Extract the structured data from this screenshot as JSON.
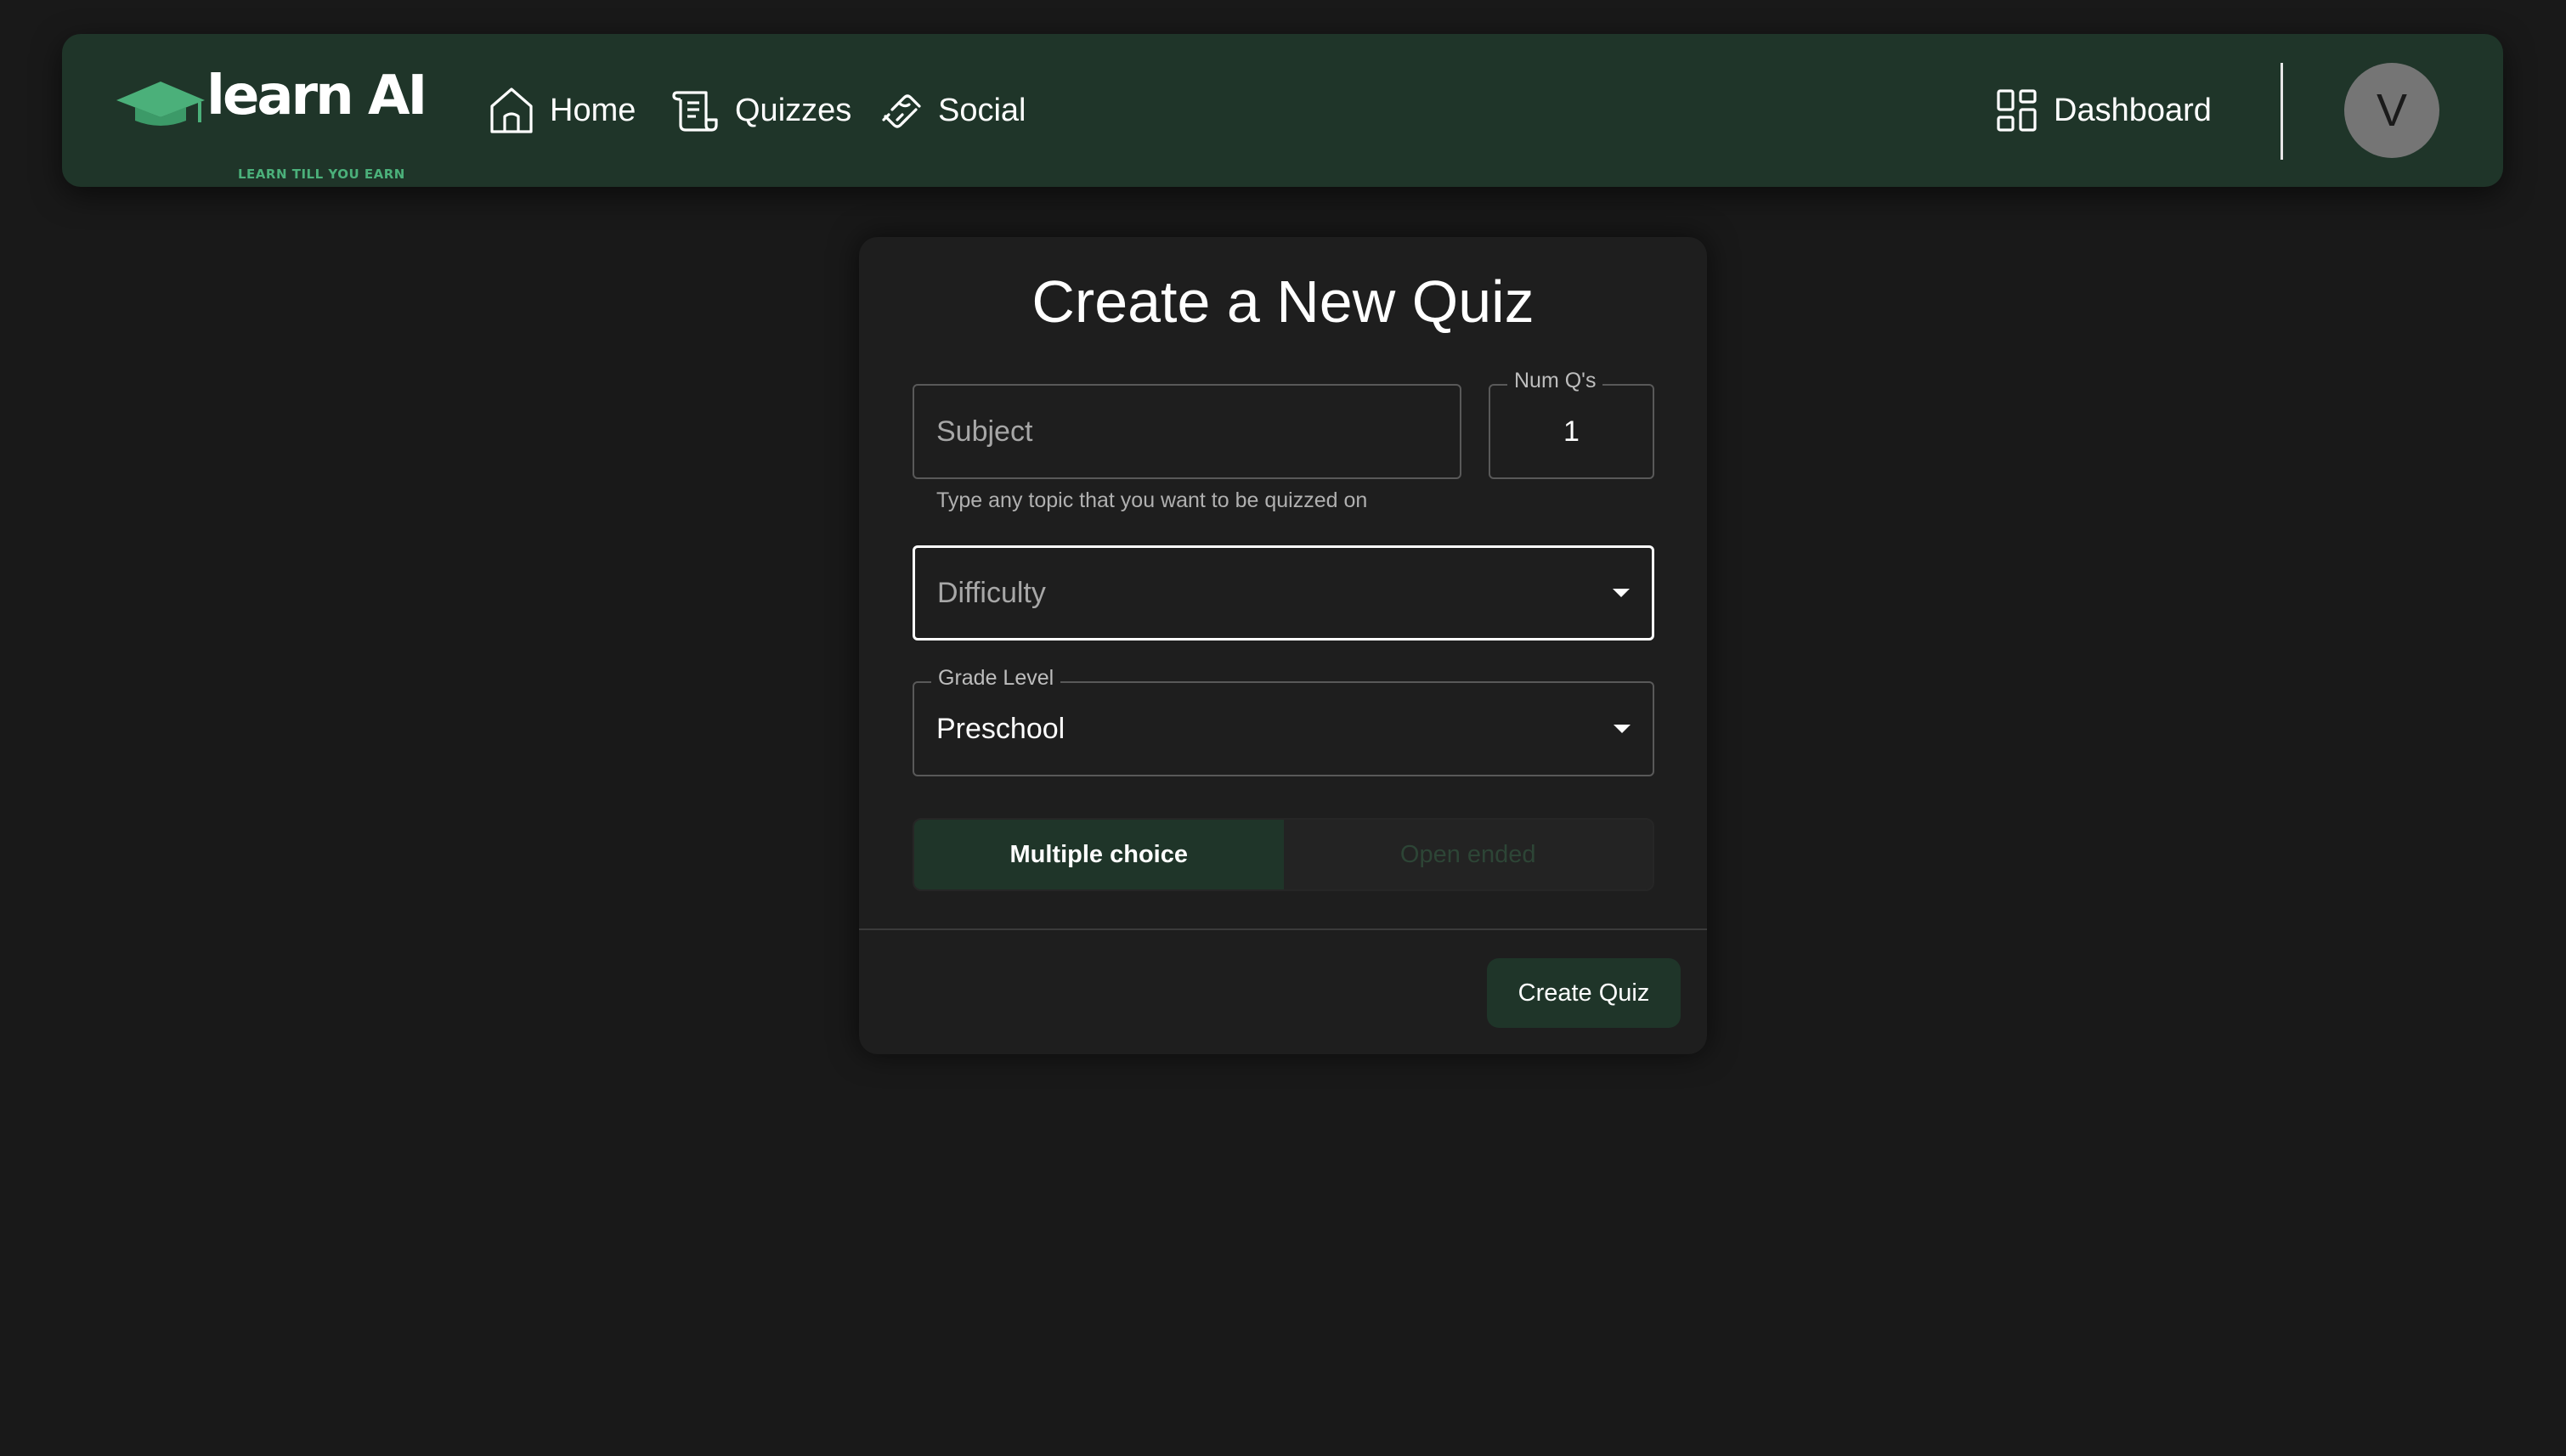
{
  "brand": {
    "name": "learn AI",
    "tagline": "LEARN TILL YOU EARN",
    "logo_icon": "graduation-cap-icon",
    "accent_color": "#4bb07a",
    "navbar_color": "#1f3529"
  },
  "nav": {
    "links": [
      {
        "label": "Home",
        "icon": "home-icon"
      },
      {
        "label": "Quizzes",
        "icon": "scroll-icon"
      },
      {
        "label": "Social",
        "icon": "handshake-icon"
      }
    ],
    "dashboard": {
      "label": "Dashboard",
      "icon": "grid-icon"
    },
    "avatar_initial": "V"
  },
  "form": {
    "title": "Create a New Quiz",
    "subject": {
      "placeholder": "Subject",
      "value": "",
      "helper": "Type any topic that you want to be quizzed on"
    },
    "num_questions": {
      "label": "Num Q's",
      "value": "1"
    },
    "difficulty": {
      "placeholder": "Difficulty",
      "value": ""
    },
    "grade_level": {
      "label": "Grade Level",
      "value": "Preschool"
    },
    "question_type": {
      "options": [
        "Multiple choice",
        "Open ended"
      ],
      "selected": "Multiple choice"
    },
    "submit_label": "Create Quiz"
  }
}
